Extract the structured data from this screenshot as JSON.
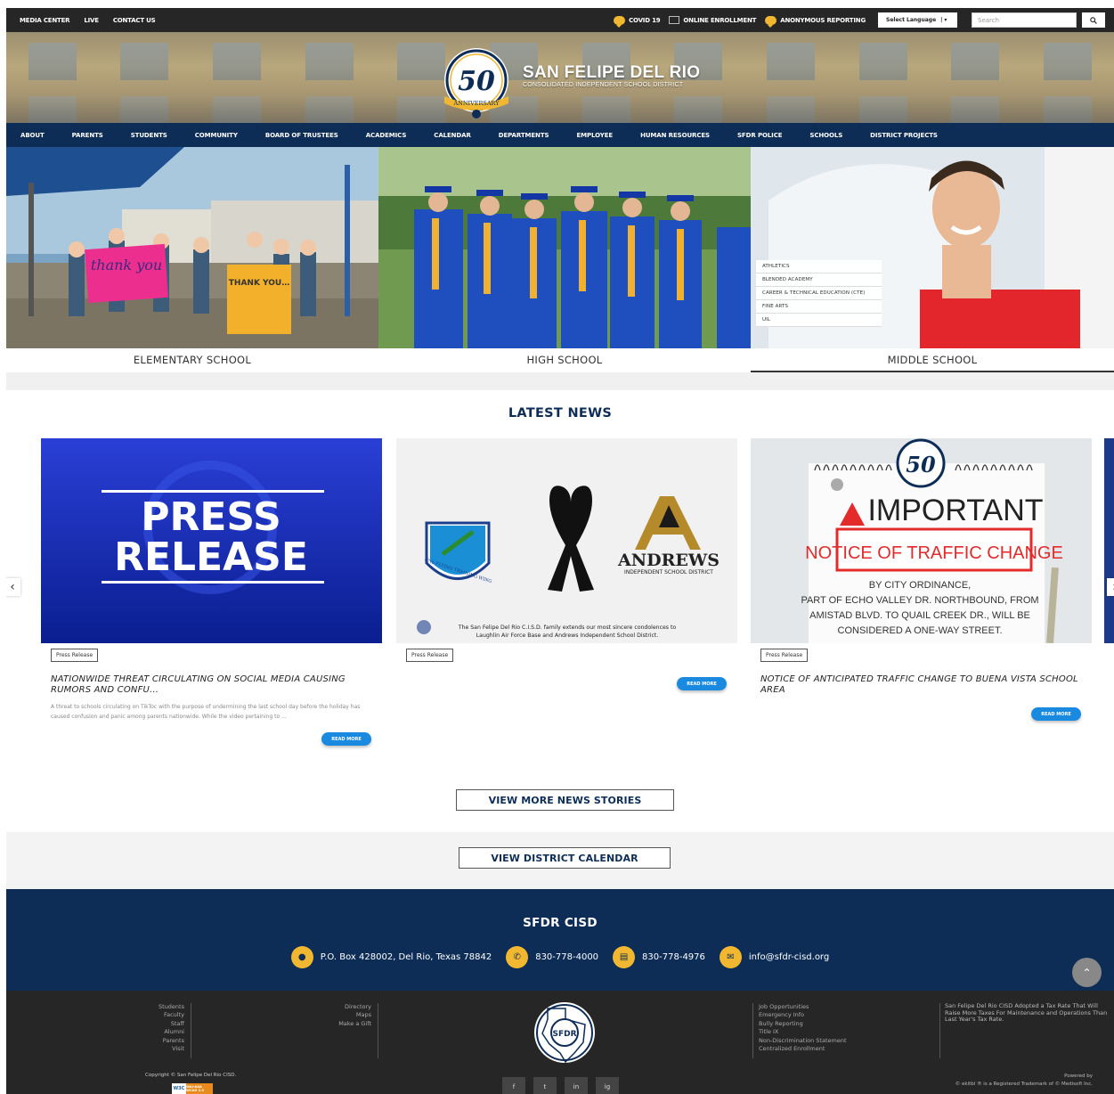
{
  "topbar": {
    "links_left": [
      "MEDIA CENTER",
      "LIVE",
      "CONTACT US"
    ],
    "covid": "COVID 19",
    "enrollment": "ONLINE ENROLLMENT",
    "anonymous": "ANONYMOUS REPORTING",
    "language": "Select Language",
    "search_placeholder": "Search"
  },
  "header": {
    "seal_number": "50",
    "seal_text": "ANNIVERSARY",
    "title": "SAN FELIPE DEL RIO",
    "subtitle": "CONSOLIDATED INDEPENDENT SCHOOL DISTRICT"
  },
  "nav": [
    "ABOUT",
    "PARENTS",
    "STUDENTS",
    "COMMUNITY",
    "BOARD OF TRUSTEES",
    "ACADEMICS",
    "CALENDAR",
    "DEPARTMENTS",
    "EMPLOYEE",
    "HUMAN RESOURCES",
    "SFDR POLICE",
    "SCHOOLS",
    "DISTRICT PROJECTS"
  ],
  "hero": {
    "panels": [
      "ELEMENTARY SCHOOL",
      "HIGH SCHOOL",
      "MIDDLE SCHOOL"
    ],
    "sign_left": "thank you",
    "sign_right": "THANK YOU FOR YOUR SUPPORT",
    "submenu": [
      "ATHLETICS",
      "BLENDED ACADEMY",
      "CAREER & TECHNICAL EDUCATION (CTE)",
      "FINE ARTS",
      "UIL"
    ]
  },
  "news": {
    "heading": "LATEST NEWS",
    "cards": [
      {
        "image_text": [
          "PRESS",
          "RELEASE"
        ],
        "badge": "Press Release",
        "title": "NATIONWIDE THREAT CIRCULATING ON SOCIAL MEDIA CAUSING RUMORS AND CONFU...",
        "excerpt": "A threat to schools circulating on TikToc with the purpose of undermining the last school day before the holiday has caused confusion and panic among parents nationwide. While the video pertaining to ...",
        "read_more": "READ MORE"
      },
      {
        "image_text": [
          "ANDREWS",
          "INDEPENDENT SCHOOL DISTRICT",
          "47th FLYING TRAINING WING",
          "The San Felipe Del Rio C.I.S.D. family extends our most sincere condolences to",
          "Laughlin Air Force Base and Andrews Independent School District."
        ],
        "badge": "Press Release",
        "read_more": "READ MORE"
      },
      {
        "image_text": [
          "IMPORTANT",
          "NOTICE OF TRAFFIC CHANGE",
          "BY CITY ORDINANCE,",
          "PART OF ECHO VALLEY DR. NORTHBOUND, FROM",
          "AMISTAD BLVD. TO QUAIL CREEK DR., WILL BE",
          "CONSIDERED A ONE-WAY STREET."
        ],
        "badge": "Press Release",
        "title": "NOTICE OF ANTICIPATED TRAFFIC CHANGE TO BUENA VISTA SCHOOL AREA",
        "read_more": "READ MORE"
      }
    ],
    "view_more": "VIEW MORE NEWS STORIES",
    "prev": "‹",
    "next": "›"
  },
  "calendar_button": "VIEW DISTRICT CALENDAR",
  "footer": {
    "name": "SFDR CISD",
    "address": "P.O. Box 428002, Del Rio, Texas 78842",
    "phone": "830-778-4000",
    "fax": "830-778-4976",
    "email": "info@sfdr-cisd.org",
    "col1": [
      "Students",
      "Faculty",
      "Staff",
      "Alumni",
      "Parents",
      "Visit"
    ],
    "col2": [
      "Directory",
      "Maps",
      "Make a Gift"
    ],
    "col3": [
      "Job Opportunities",
      "Emergency Info",
      "Bully Reporting",
      "Title IX",
      "Non-Discrimination Statement",
      "Centralized Enrollment"
    ],
    "tax_notice": "San Felipe Del Rio CISD Adopted a Tax Rate That Will Raise More Taxes For Maintenance and Operations Than Last Year's Tax Rate.",
    "seal_text": "SFDR",
    "copyright": "Copyright © San Felipe Del Rio CISD.",
    "w3c": [
      "W3C",
      "WAI-AAA WCAG 2.0"
    ],
    "social": [
      "f",
      "t",
      "in",
      "ig"
    ],
    "powered_by": "Powered by",
    "trademark": "© ekitbl ® is a Registered Trademark of © Medisoft Inc."
  },
  "colors": {
    "navy": "#0d2d57",
    "gold": "#f1b731",
    "link_blue": "#1a8ae0",
    "dark": "#262626"
  }
}
